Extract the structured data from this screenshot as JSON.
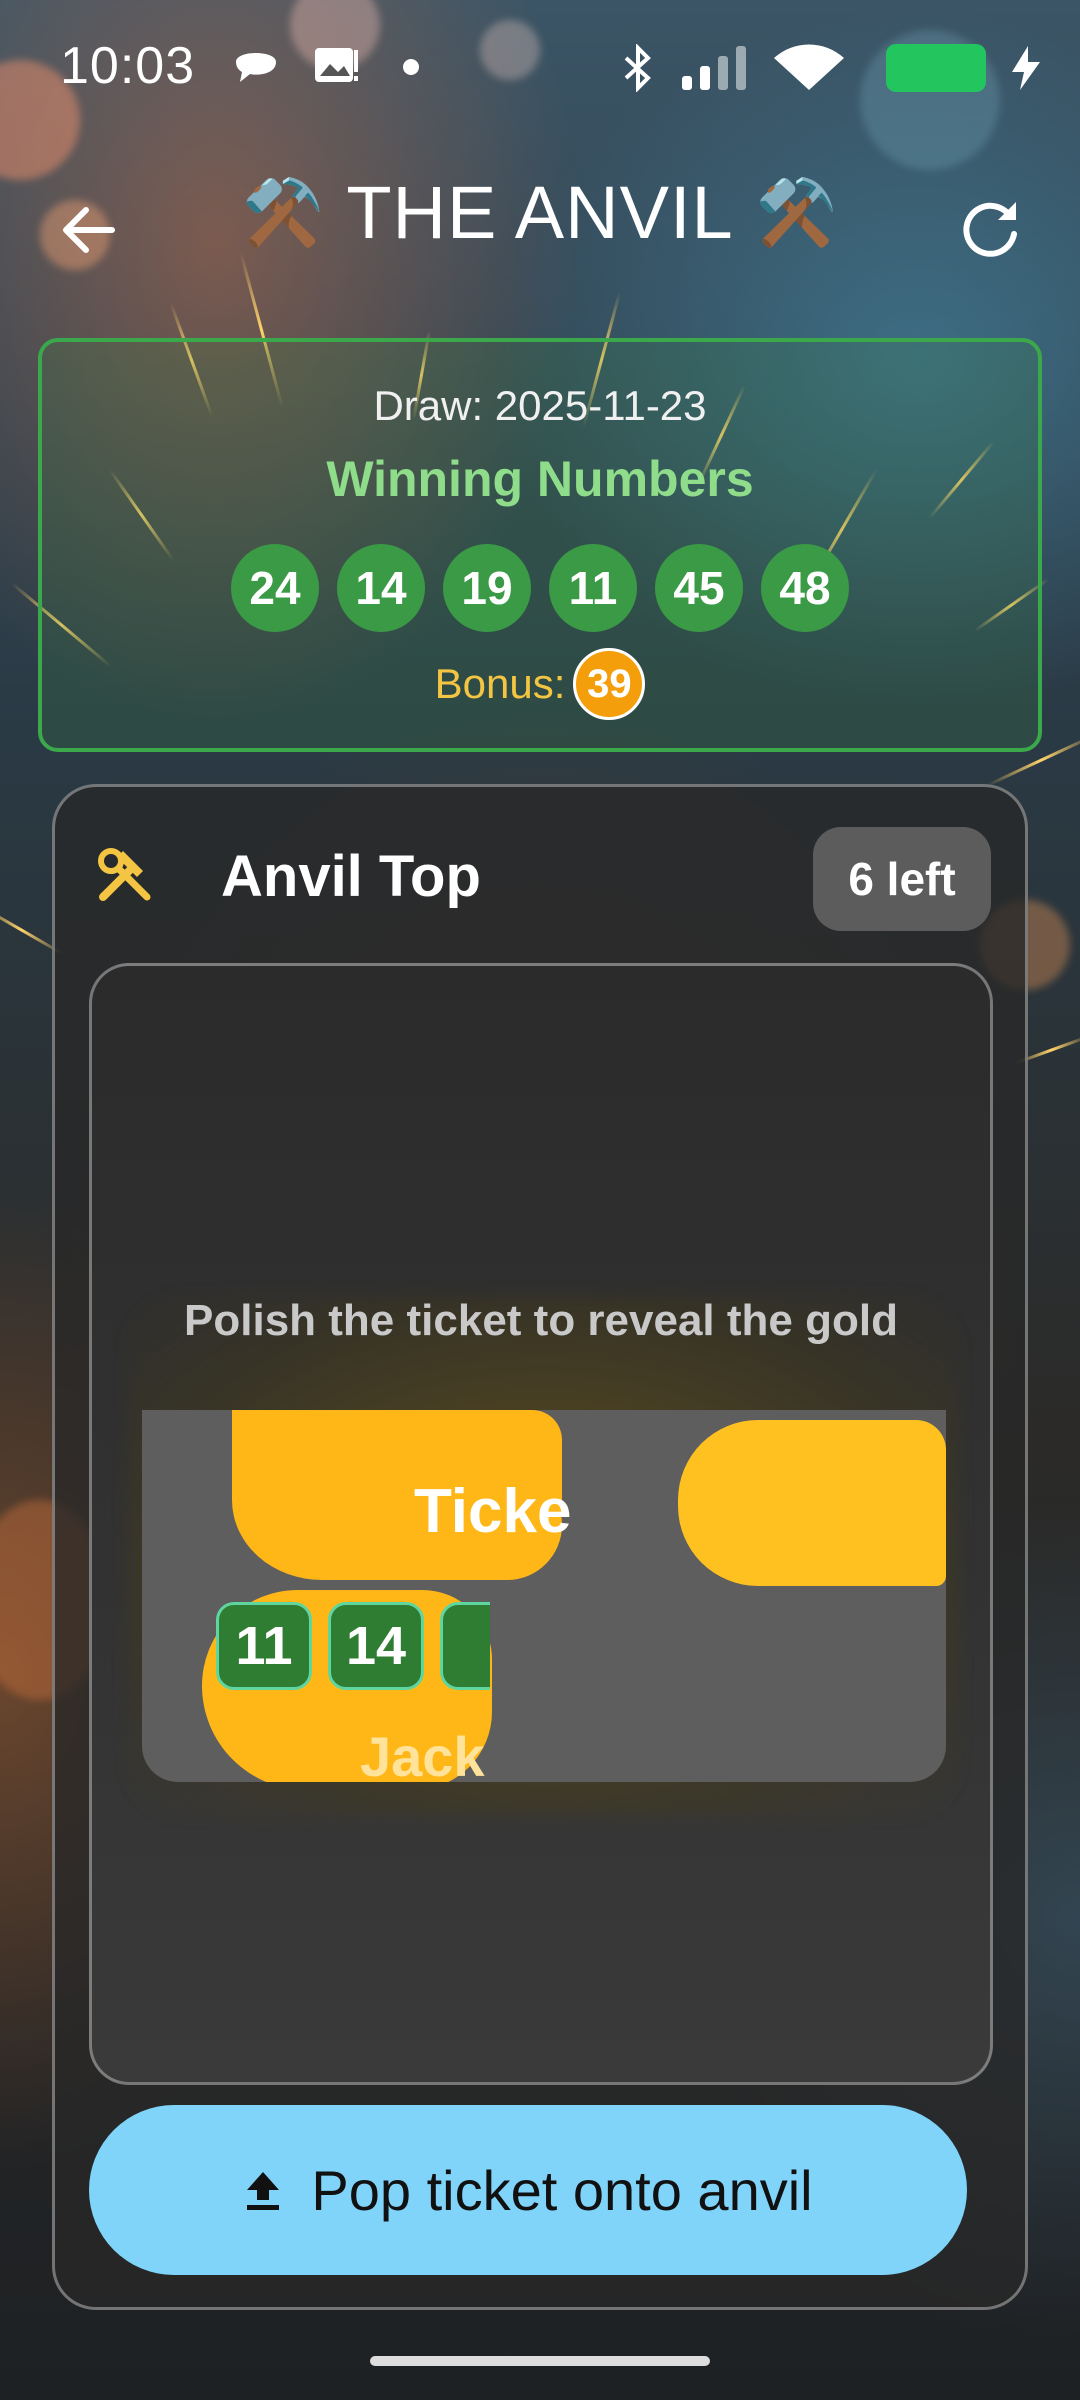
{
  "status_bar": {
    "time": "10:03"
  },
  "app_bar": {
    "title": "THE ANVIL",
    "title_emoji": "⚒️",
    "icons": {
      "back": "arrow-left-icon",
      "refresh": "refresh-icon"
    }
  },
  "draw": {
    "date_label": "Draw: 2025-11-23",
    "title": "Winning Numbers",
    "numbers": [
      "24",
      "14",
      "19",
      "11",
      "45",
      "48"
    ],
    "bonus_label": "Bonus:",
    "bonus": "39"
  },
  "anvil": {
    "title": "Anvil Top",
    "tickets_left": "6 left",
    "hint": "Polish the ticket to reveal the gold",
    "ticket_label": "Ticke",
    "ticket_numbers": [
      "11",
      "14"
    ],
    "jackpot_label": "Jack",
    "button_label": "Pop ticket onto anvil"
  },
  "colors": {
    "ball_green": "#3a9a45",
    "bonus_orange": "#f59e0b",
    "button_blue": "#80d4fa",
    "gold": "#ffb718"
  }
}
